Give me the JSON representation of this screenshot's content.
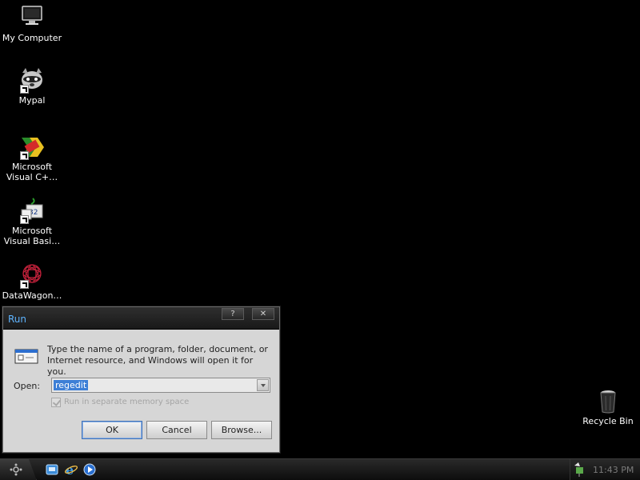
{
  "desktop": {
    "icons": [
      {
        "label": "My Computer",
        "icon": "monitor-icon"
      },
      {
        "label": "Mypal",
        "icon": "raccoon-icon"
      },
      {
        "label": "Microsoft\nVisual C+…",
        "icon": "visual-cpp-icon"
      },
      {
        "label": "Microsoft\nVisual Basi…",
        "icon": "visual-basic-icon"
      },
      {
        "label": "DataWagon…",
        "icon": "datawagon-icon"
      }
    ],
    "recycle_bin": {
      "label": "Recycle Bin",
      "icon": "trash-can-icon"
    }
  },
  "run_dialog": {
    "title": "Run",
    "help_glyph": "?",
    "close_glyph": "✕",
    "description": "Type the name of a program, folder, document, or Internet resource, and Windows will open it for you.",
    "open_label": "Open:",
    "open_value": "regedit",
    "checkbox_label": "Run in separate memory space",
    "buttons": {
      "ok": "OK",
      "cancel": "Cancel",
      "browse": "Browse..."
    }
  },
  "taskbar": {
    "start_icon": "start-orb-icon",
    "quick_launch": [
      "desktop-icon",
      "internet-explorer-icon",
      "media-player-icon"
    ],
    "tray_icon": "network-icon",
    "clock": "11:43 PM"
  },
  "colors": {
    "desktop_bg": "#000000",
    "title_text": "#5fb4ff",
    "selection": "#3d7fd6"
  }
}
